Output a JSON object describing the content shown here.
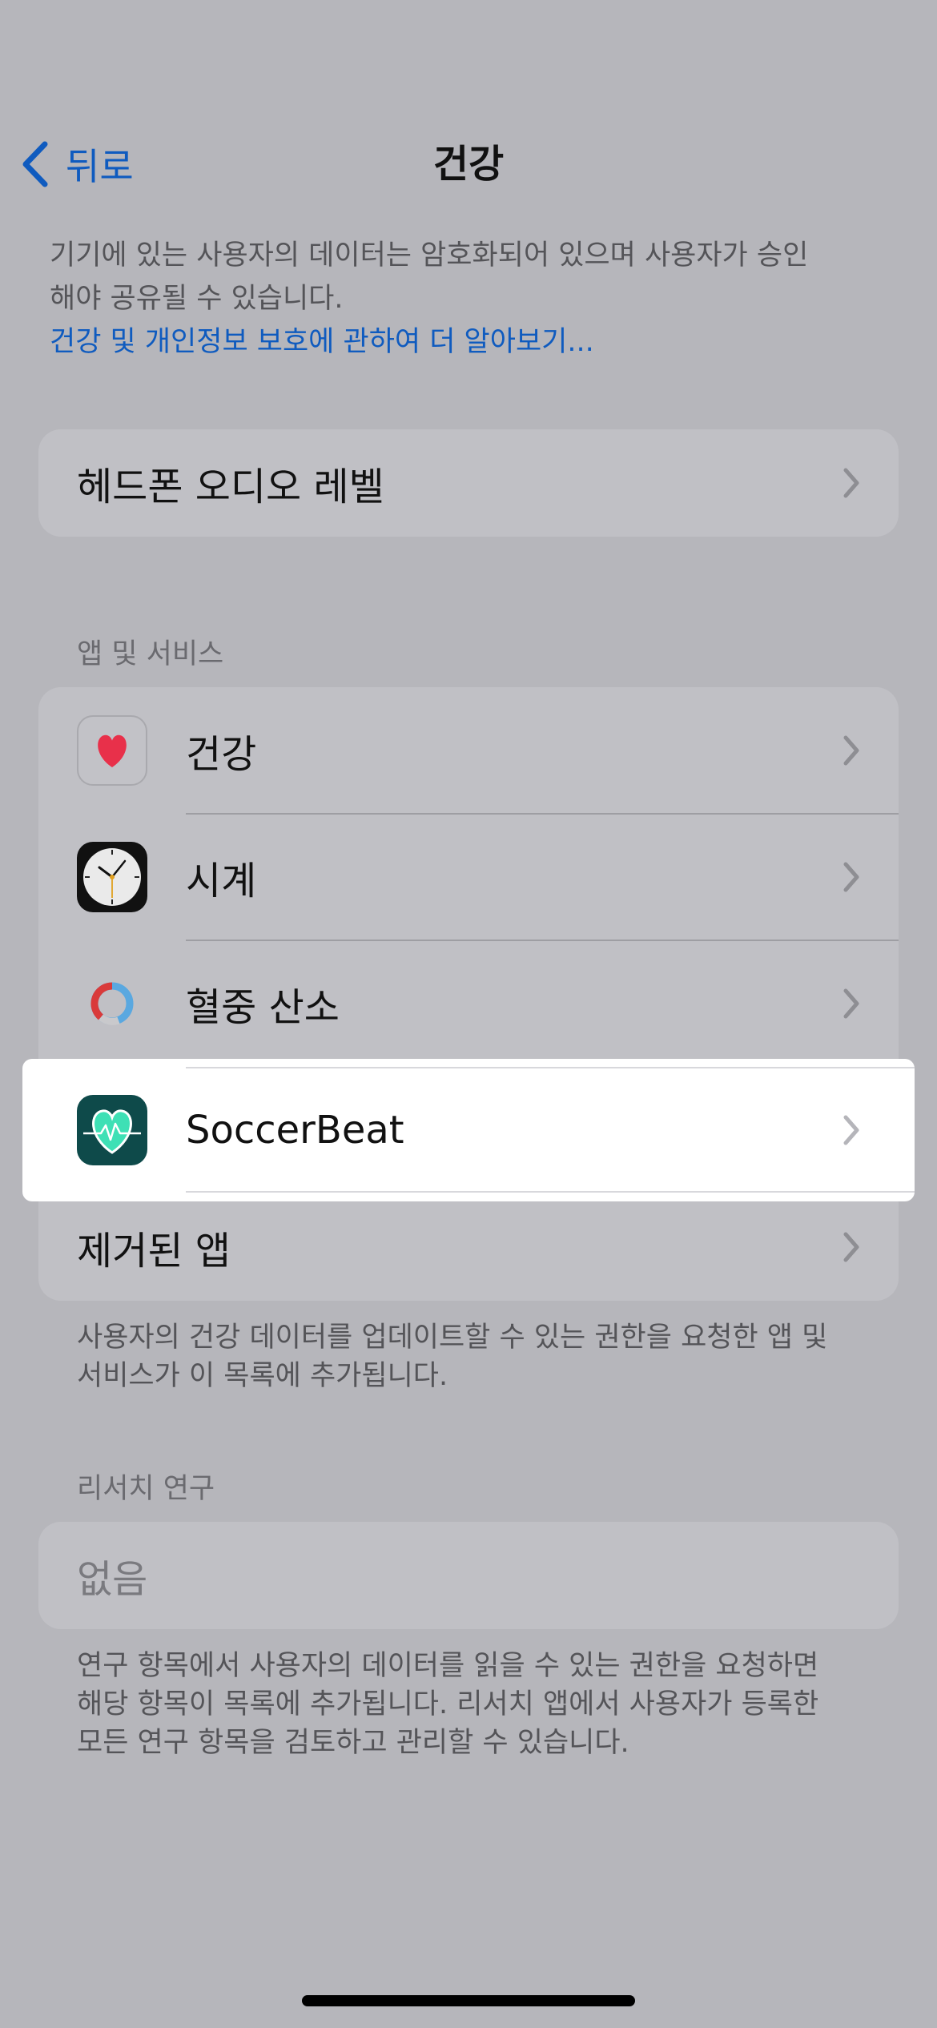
{
  "nav": {
    "back_label": "뒤로",
    "title": "건강"
  },
  "intro": {
    "line1": "기기에 있는 사용자의 데이터는 암호화되어 있으며 사용자가 승인",
    "line2": "해야 공유될 수 있습니다.",
    "link": "건강 및 개인정보 보호에 관하여 더 알아보기..."
  },
  "headphone": {
    "label": "헤드폰 오디오 레벨"
  },
  "apps_section": {
    "header": "앱 및 서비스",
    "items": [
      {
        "label": "건강",
        "icon": "health-app-icon"
      },
      {
        "label": "시계",
        "icon": "clock-app-icon"
      },
      {
        "label": "혈중 산소",
        "icon": "blood-oxygen-app-icon"
      },
      {
        "label": "SoccerBeat",
        "icon": "soccerbeat-app-icon"
      }
    ],
    "removed_label": "제거된 앱",
    "footer_line1": "사용자의 건강 데이터를 업데이트할 수 있는 권한을 요청한 앱 및",
    "footer_line2": "서비스가 이 목록에 추가됩니다."
  },
  "research_section": {
    "header": "리서치 연구",
    "none_label": "없음",
    "footer_line1": "연구 항목에서 사용자의 데이터를 읽을 수 있는 권한을 요청하면",
    "footer_line2": "해당 항목이 목록에 추가됩니다. 리서치 앱에서 사용자가 등록한",
    "footer_line3": "모든 연구 항목을 검토하고 관리할 수 있습니다."
  },
  "colors": {
    "dimmed_background": "#b6b6bb",
    "card_background": "#c0c0c5",
    "link_blue": "#0f5bbf",
    "highlight": "#ffffff",
    "health_heart": "#e8304a",
    "soccerbeat_teal": "#3ee0b5"
  }
}
